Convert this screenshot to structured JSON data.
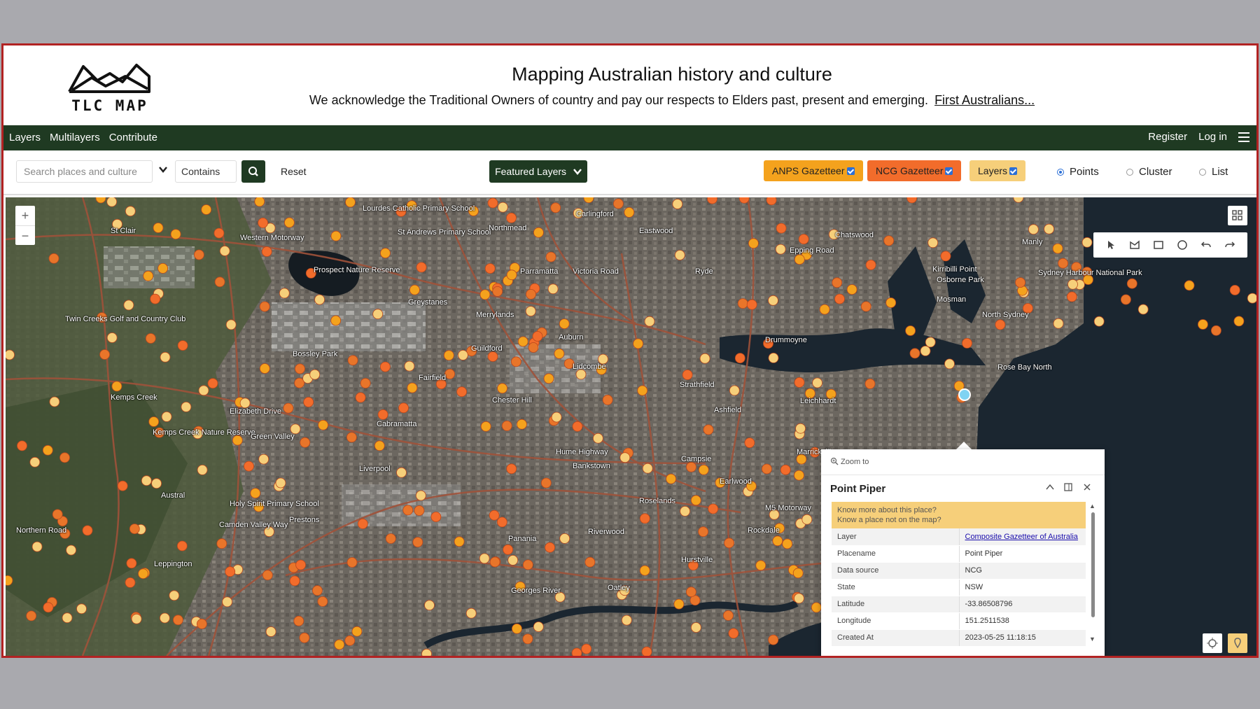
{
  "header": {
    "logo_text": "TLC MAP",
    "title": "Mapping Australian history and culture",
    "acknowledgement": "We acknowledge the Traditional Owners of country and pay our respects to Elders past, present and emerging.",
    "acknowledgement_link": "First Australians..."
  },
  "nav": {
    "left": [
      "Layers",
      "Multilayers",
      "Contribute"
    ],
    "register": "Register",
    "login": "Log in"
  },
  "toolbar": {
    "search_placeholder": "Search places and culture",
    "match_mode": "Contains",
    "reset": "Reset",
    "featured_layers": "Featured Layers",
    "chips": {
      "anps": "ANPS Gazetteer",
      "ncg": "NCG Gazetteer",
      "layers": "Layers"
    },
    "view_modes": [
      "Points",
      "Cluster",
      "List"
    ],
    "selected_view": "Points"
  },
  "colors": {
    "header_green": "#1f3a22",
    "anps": "#f4a21d",
    "ncg": "#f26c2b",
    "layers": "#f6cf7a"
  },
  "map": {
    "places": [
      "St Clair",
      "Western Motorway",
      "Prospect Nature Reserve",
      "Lourdes Catholic Primary School",
      "St Andrews Primary School",
      "Northmead",
      "Carlingford",
      "Eastwood",
      "Chatswood",
      "Manly",
      "Parramatta",
      "Victoria Road",
      "Ryde",
      "Epping Road",
      "Greystanes",
      "Merrylands",
      "Twin Creeks Golf and Country Club",
      "Bossley Park",
      "Guildford",
      "Auburn",
      "North Sydney",
      "Mosman",
      "Sydney Harbour National Park",
      "Drummoyne",
      "Lidcombe",
      "Fairfield",
      "Kemps Creek",
      "Strathfield",
      "Chester Hill",
      "Cabramatta",
      "Ashfield",
      "Leichhardt",
      "Kemps Creek Nature Reserve",
      "Green Valley",
      "Campsie",
      "Marrickville",
      "Liverpool",
      "Bankstown",
      "Earlwood",
      "Austral",
      "Roselands",
      "M5 Motorway",
      "Holy Spirit Primary School",
      "Prestons",
      "Riverwood",
      "Panania",
      "Rockdale",
      "Leppington",
      "Hurstville",
      "Oatley",
      "Georges River",
      "Northern Road",
      "Elizabeth Drive",
      "Hume Highway",
      "Camden Valley Way",
      "Rose Bay North",
      "Kirribilli Point",
      "Osborne Park"
    ]
  },
  "popup": {
    "zoom_to": "Zoom to",
    "title": "Point Piper",
    "ask_line1": "Know more about this place?",
    "ask_line2": "Know a place not on the map?",
    "rows": [
      {
        "key": "Layer",
        "value": "Composite Gazetteer of Australia"
      },
      {
        "key": "Placename",
        "value": "Point Piper"
      },
      {
        "key": "Data source",
        "value": "NCG"
      },
      {
        "key": "State",
        "value": "NSW"
      },
      {
        "key": "Latitude",
        "value": "-33.86508796"
      },
      {
        "key": "Longitude",
        "value": "151.2511538"
      },
      {
        "key": "Created At",
        "value": "2023-05-25 11:18:15"
      }
    ]
  }
}
